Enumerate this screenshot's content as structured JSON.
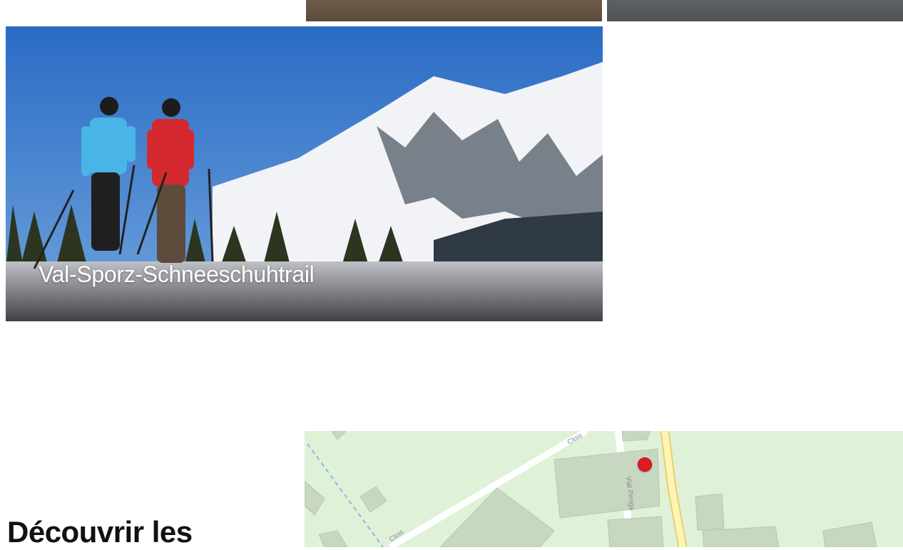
{
  "trail_card": {
    "title": "Val-Sporz-Schneeschuhtrail"
  },
  "section": {
    "heading": "Découvrir les"
  },
  "map": {
    "street_labels": [
      "Clois",
      "Clois",
      "Vial Pirnga"
    ],
    "pin_color": "#e11b22",
    "background_color": "#dff2d8"
  }
}
